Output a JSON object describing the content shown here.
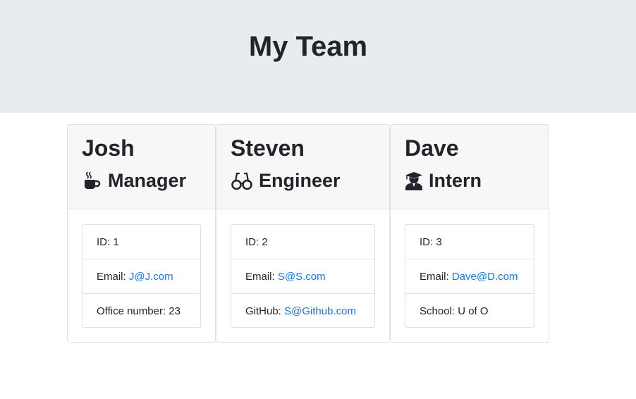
{
  "header": {
    "title": "My Team"
  },
  "employees": [
    {
      "name": "Josh",
      "role": "Manager",
      "icon": "coffee-icon",
      "id_label": "ID: 1",
      "email_label": "Email: ",
      "email": "J@J.com",
      "extra_label": "Office number: ",
      "extra_value": "23"
    },
    {
      "name": "Steven",
      "role": "Engineer",
      "icon": "glasses-icon",
      "id_label": "ID: 2",
      "email_label": "Email: ",
      "email": "S@S.com",
      "extra_label": "GitHub: ",
      "extra_value": "S@Github.com"
    },
    {
      "name": "Dave",
      "role": "Intern",
      "icon": "graduate-icon",
      "id_label": "ID: 3",
      "email_label": "Email: ",
      "email": "Dave@D.com",
      "extra_label": "School: ",
      "extra_value": "U of O"
    }
  ],
  "colors": {
    "header_bg": "#e9ecef",
    "card_header_bg": "#f7f7f7",
    "link": "#1a73e8",
    "text": "#212529"
  }
}
